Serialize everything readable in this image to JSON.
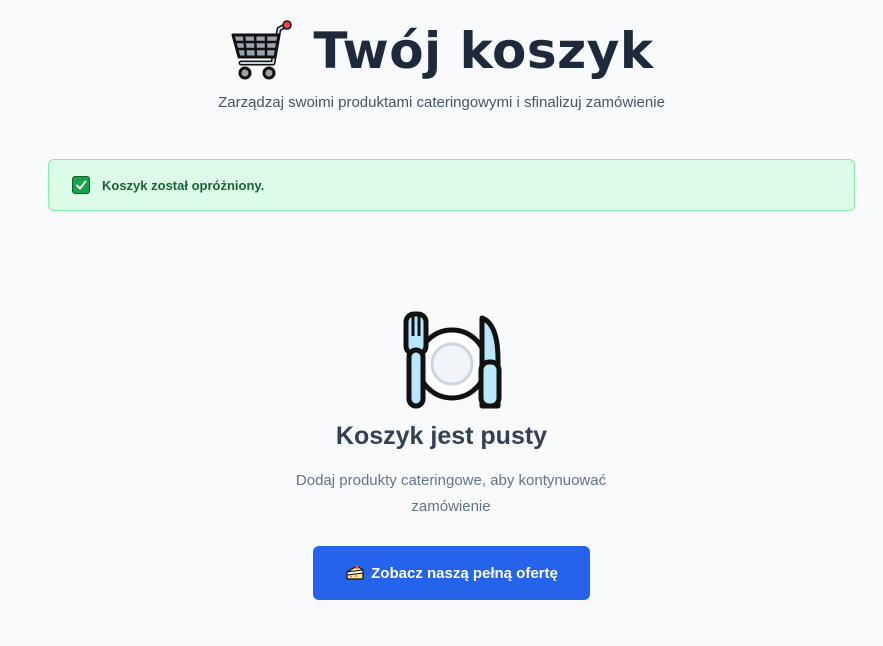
{
  "header": {
    "icon": "shopping-cart-icon",
    "title": "Twój koszyk",
    "subtitle": "Zarządzaj swoimi produktami cateringowymi i sfinalizuj zamówienie"
  },
  "alert": {
    "icon": "check-mark-icon",
    "text": "Koszyk został opróżniony.",
    "color": "#16a34a"
  },
  "empty_state": {
    "icon": "fork-knife-plate-icon",
    "title": "Koszyk jest pusty",
    "description": "Dodaj produkty cateringowe, aby kontynuować zamówienie"
  },
  "cta": {
    "icon": "cake-slice-icon",
    "label": "Zobacz naszą pełną ofertę",
    "color": "#2563eb"
  }
}
